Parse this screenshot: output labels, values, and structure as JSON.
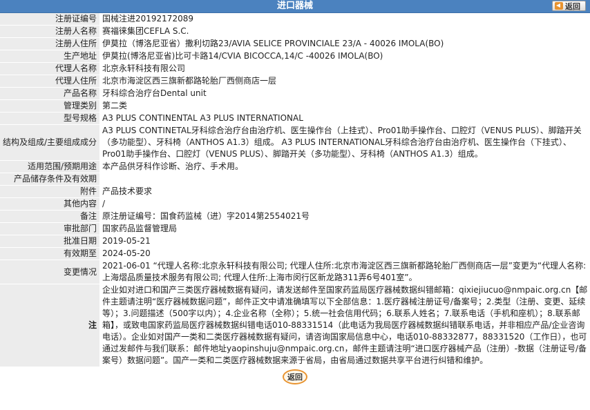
{
  "header": {
    "title": "进口器械",
    "back_label": "返回",
    "back_icon": "back-arrow-icon"
  },
  "rows": [
    {
      "key": "reg_no",
      "label": "注册证编号",
      "value": "国械注进20192172089"
    },
    {
      "key": "registrant_name",
      "label": "注册人名称",
      "value": "赛福徕集团CEFLA S.C."
    },
    {
      "key": "registrant_address",
      "label": "注册人住所",
      "value": "伊莫拉（博洛尼亚省）撒利切路23/AVIA SELICE PROVINCIALE 23/A - 40026 IMOLA(BO)"
    },
    {
      "key": "production_address",
      "label": "生产地址",
      "value": "伊莫拉(博洛尼亚省)比可卡路14/CVIA BICOCCA,14/C -40026 IMOLA(BO)"
    },
    {
      "key": "agent_name",
      "label": "代理人名称",
      "value": "北京永轩科技有限公司"
    },
    {
      "key": "agent_address",
      "label": "代理人住所",
      "value": "北京市海淀区西三旗新都路轮胎厂西侧商店一层"
    },
    {
      "key": "product_name",
      "label": "产品名称",
      "value": "牙科综合治疗台Dental unit"
    },
    {
      "key": "category",
      "label": "管理类别",
      "value": "第二类"
    },
    {
      "key": "model",
      "label": "型号规格",
      "value": "A3 PLUS CONTINENTAL A3 PLUS INTERNATIONAL"
    },
    {
      "key": "composition",
      "label": "结构及组成/主要组成成分",
      "value": "A3 PLUS CONTINETAL牙科综合治疗台由治疗机、医生操作台（上挂式）、Pro01助手操作台、口腔灯（VENUS PLUS）、脚踏开关（多功能型）、牙科椅（ANTHOS A1.3）组成。 A3 PLUS INTERNATIONAL牙科综合治疗台由治疗机、医生操作台（下挂式）、Pro01助手操作台、口腔灯（VENUS PLUS）、脚踏开关（多功能型）、牙科椅（ANTHOS A1.3）组成。"
    },
    {
      "key": "scope",
      "label": "适用范围/预期用途",
      "value": "本产品供牙科作诊断、治疗、手术用。"
    },
    {
      "key": "storage",
      "label": "产品储存条件及有效期",
      "value": ""
    },
    {
      "key": "attachment",
      "label": "附件",
      "value": "产品技术要求"
    },
    {
      "key": "other",
      "label": "其他内容",
      "value": "/"
    },
    {
      "key": "remarks",
      "label": "备注",
      "value": "原注册证编号：国食药监械（进）字2014第2554021号"
    },
    {
      "key": "approval_dept",
      "label": "审批部门",
      "value": "国家药品监督管理局"
    },
    {
      "key": "approval_date",
      "label": "批准日期",
      "value": "2019-05-21"
    },
    {
      "key": "expiry",
      "label": "有效期至",
      "value": "2024-05-20"
    },
    {
      "key": "changes",
      "label": "变更情况",
      "value": "2021-06-01 “代理人名称:北京永轩科技有限公司; 代理人住所:北京市海淀区西三旗新都路轮胎厂西侧商店一层”变更为“代理人名称:上海熠品质量技术服务有限公司; 代理人住所:上海市闵行区新龙路311弄6号401室”。"
    },
    {
      "key": "note",
      "label": "注",
      "value": "企业如对进口和国产三类医疗器械数据有疑问，请发送邮件至国家药监局医疗器械数据纠错邮箱：qixiejiucuo@nmpaic.org.cn【邮件主题请注明“医疗器械数据问题”，邮件正文中请准确填写以下全部信息：1.医疗器械注册证号/备案号；2.类型（注册、变更、延续等）；3.问题描述（500字以内）；4.企业名称（全称）；5.统一社会信用代码；6.联系人姓名；7.联系电话（手机和座机）；8.联系邮箱】，或致电国家药监局医疗器械数据纠错电话010-88331514（此电话为我局医疗器械数据纠错联系电话，并非相应产品/企业咨询电话）。企业如对国产一类和二类医疗器械数据有疑问，请咨询国家局信息中心，电话010-88332877，88331520（工作日），也可通过发邮件与我们联系：邮件地址yaopinshuju@nmpaic.org.cn，邮件主题请注明“进口医疗器械产品（注册）-数据（注册证号/备案号）数据问题”。国产一类和二类医疗器械数据来源于省局，由省局通过数据共享平台进行纠错和维护。"
    }
  ],
  "footer": {
    "back_label": "返回"
  }
}
